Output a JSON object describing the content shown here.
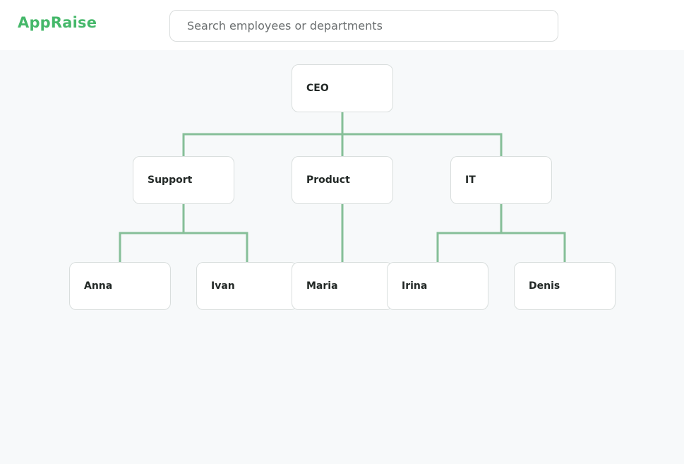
{
  "app": {
    "name": "AppRaise"
  },
  "search": {
    "placeholder": "Search employees or departments",
    "value": ""
  },
  "org_chart": {
    "root": {
      "label": "CEO"
    },
    "departments": [
      {
        "label": "Support",
        "members": [
          "Anna",
          "Ivan"
        ]
      },
      {
        "label": "Product",
        "members": [
          "Maria"
        ]
      },
      {
        "label": "IT",
        "members": [
          "Irina",
          "Denis"
        ]
      }
    ]
  },
  "colors": {
    "brand": "#45b86a",
    "connector": "#86bf98",
    "node_border": "#d9dedd",
    "background": "#f7f9fa"
  }
}
